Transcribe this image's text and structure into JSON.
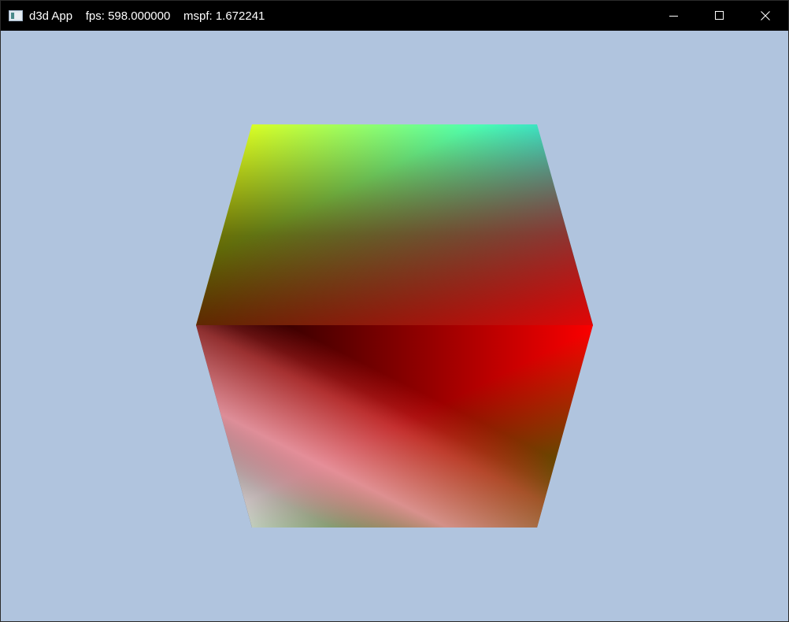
{
  "window": {
    "title": "d3d App    fps: 598.000000    mspf: 1.672241",
    "controls": {
      "minimize_icon": "minimize-icon",
      "maximize_icon": "maximize-icon",
      "close_icon": "close-icon"
    }
  },
  "viewport": {
    "clear_color": "#b0c4de",
    "object": "cube",
    "vertex_colors": {
      "top_left": "#ffff00",
      "top_right": "#00ffff",
      "mid_left": "#000000",
      "mid_right": "#ff0000",
      "bottom_left": "#ffffff",
      "bottom_right": "#008000"
    }
  }
}
